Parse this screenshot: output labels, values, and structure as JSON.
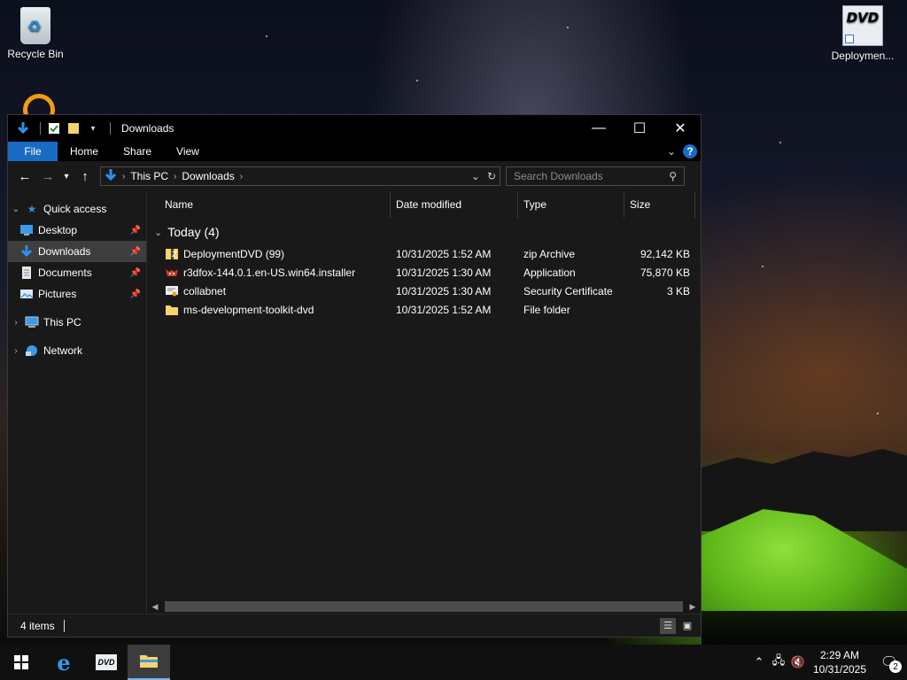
{
  "desktop": {
    "icons": [
      {
        "label": "Recycle Bin",
        "icon": "recycle-bin-icon"
      },
      {
        "label": "Deploymen...",
        "icon": "dvd-icon"
      }
    ]
  },
  "window": {
    "title": "Downloads",
    "caption": {
      "minimize": "—",
      "maximize": "☐",
      "close": "✕"
    },
    "ribbon_tabs": [
      "File",
      "Home",
      "Share",
      "View"
    ],
    "help": "?"
  },
  "address": {
    "crumbs": [
      "This PC",
      "Downloads"
    ],
    "search_placeholder": "Search Downloads"
  },
  "nav": {
    "quick_access": "Quick access",
    "items": [
      {
        "label": "Desktop",
        "pinned": true
      },
      {
        "label": "Downloads",
        "pinned": true,
        "selected": true
      },
      {
        "label": "Documents",
        "pinned": true
      },
      {
        "label": "Pictures",
        "pinned": true
      }
    ],
    "this_pc": "This PC",
    "network": "Network"
  },
  "columns": {
    "name": "Name",
    "date": "Date modified",
    "type": "Type",
    "size": "Size"
  },
  "group": {
    "label": "Today (4)"
  },
  "files": [
    {
      "name": "DeploymentDVD (99)",
      "date": "10/31/2025 1:52 AM",
      "type": "zip Archive",
      "size": "92,142 KB",
      "icon": "zip-archive-icon"
    },
    {
      "name": "r3dfox-144.0.1.en-US.win64.installer",
      "date": "10/31/2025 1:30 AM",
      "type": "Application",
      "size": "75,870 KB",
      "icon": "firefox-app-icon"
    },
    {
      "name": "collabnet",
      "date": "10/31/2025 1:30 AM",
      "type": "Security Certificate",
      "size": "3 KB",
      "icon": "certificate-icon"
    },
    {
      "name": "ms-development-toolkit-dvd",
      "date": "10/31/2025 1:52 AM",
      "type": "File folder",
      "size": "",
      "icon": "folder-icon"
    }
  ],
  "status": {
    "items": "4 items"
  },
  "taskbar": {
    "time": "2:29 AM",
    "date": "10/31/2025",
    "notifications": "2",
    "dvd_label": "DVD"
  },
  "colors": {
    "accent": "#1a6bc4",
    "window_bg": "#191919",
    "selected": "#3e3e3e",
    "folder": "#f7d46b"
  }
}
